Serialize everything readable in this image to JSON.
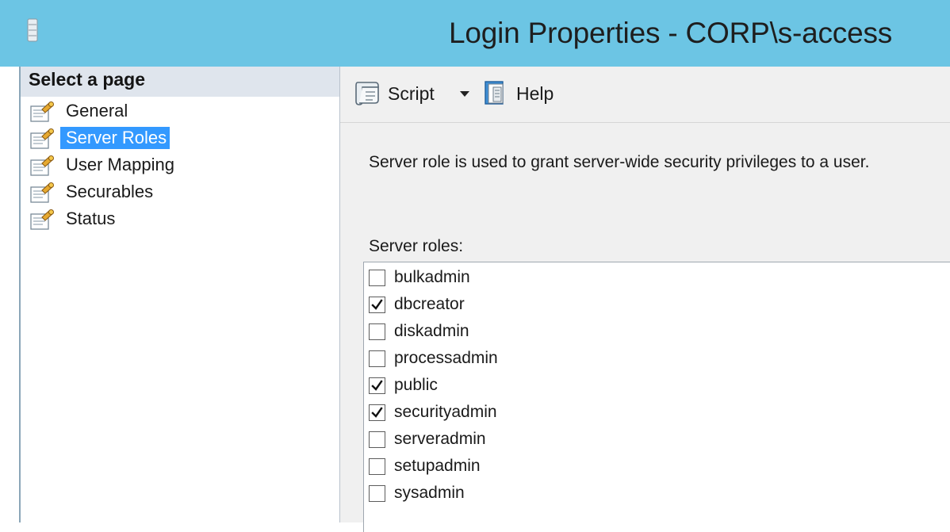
{
  "window": {
    "title": "Login Properties - CORP\\s-access",
    "app_icon": "database-icon",
    "title_bar_color": "#6cc5e4"
  },
  "sidebar": {
    "header": "Select a page",
    "item_icon": "page-wrench-icon",
    "items": [
      {
        "label": "General",
        "selected": false
      },
      {
        "label": "Server Roles",
        "selected": true
      },
      {
        "label": "User Mapping",
        "selected": false
      },
      {
        "label": "Securables",
        "selected": false
      },
      {
        "label": "Status",
        "selected": false
      }
    ],
    "selection_color": "#3399ff"
  },
  "toolbar": {
    "script_label": "Script",
    "script_icon": "script-scroll-icon",
    "dropdown_icon": "chevron-down-icon",
    "help_label": "Help",
    "help_icon": "help-book-icon"
  },
  "main": {
    "description": "Server role is used to grant server-wide security privileges to a user.",
    "roles_label": "Server roles:",
    "roles": [
      {
        "name": "bulkadmin",
        "checked": false
      },
      {
        "name": "dbcreator",
        "checked": true
      },
      {
        "name": "diskadmin",
        "checked": false
      },
      {
        "name": "processadmin",
        "checked": false
      },
      {
        "name": "public",
        "checked": true
      },
      {
        "name": "securityadmin",
        "checked": true
      },
      {
        "name": "serveradmin",
        "checked": false
      },
      {
        "name": "setupadmin",
        "checked": false
      },
      {
        "name": "sysadmin",
        "checked": false
      }
    ]
  }
}
